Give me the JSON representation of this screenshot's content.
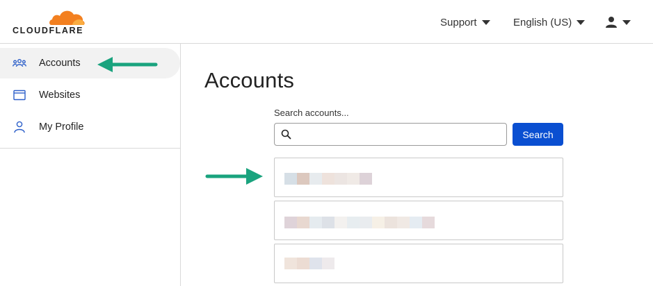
{
  "header": {
    "logo_text": "CLOUDFLARE",
    "nav": [
      {
        "label": "Support"
      },
      {
        "label": "English (US)"
      }
    ],
    "user_menu_icon": "user-icon"
  },
  "sidebar": {
    "items": [
      {
        "label": "Accounts",
        "icon": "accounts-icon",
        "active": true
      },
      {
        "label": "Websites",
        "icon": "browser-window-icon",
        "active": false
      },
      {
        "label": "My Profile",
        "icon": "user-outline-icon",
        "active": false
      }
    ]
  },
  "main": {
    "title": "Accounts",
    "search": {
      "label": "Search accounts...",
      "value": "",
      "placeholder": "",
      "button_label": "Search"
    },
    "accounts_redacted": 3
  },
  "colors": {
    "brand_orange": "#f38020",
    "primary_blue": "#0a4fd1",
    "annotation_green": "#1aa37e"
  }
}
